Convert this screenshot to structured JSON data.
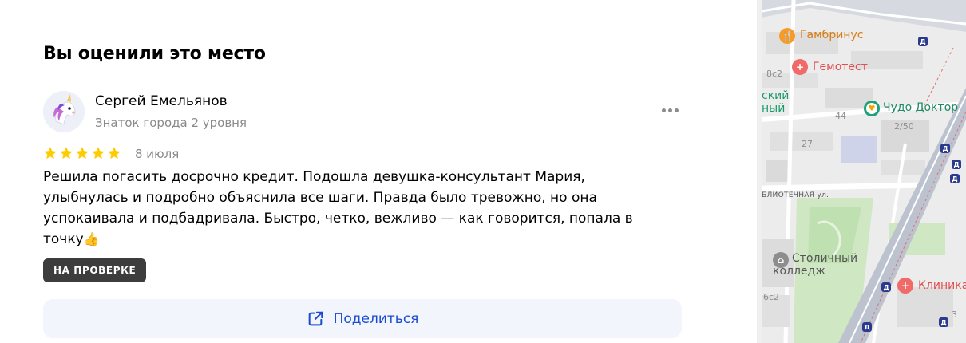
{
  "review": {
    "section_title": "Вы оценили это место",
    "author_name": "Сергей Емельянов",
    "author_level": "Знаток города 2 уровня",
    "avatar_icon": "unicorn-icon",
    "rating": 5,
    "date": "8 июля",
    "text": "Решила погасить досрочно кредит. Подошла девушка-консультант Мария, улыбнулась и подробно объяснила все шаги. Правда было тревожно, но она успокаивала и подбадривала. Быстро, четко, вежливо — как говорится, попала в точку",
    "text_emoji": "👍",
    "status_badge": "НА ПРОВЕРКЕ",
    "share_label": "Поделиться",
    "more_icon": "more-dots-icon"
  },
  "map": {
    "labels": {
      "gambrinus": "Гамбринус",
      "gemotest": "Гемотест",
      "chudo_doktor": "Чудо Доктор",
      "street": "БЛИОТЕЧНАЯ ул.",
      "college": "Столичный колледж",
      "clinic": "Клиника",
      "partial_1": "ский",
      "partial_2": "ный"
    },
    "house_numbers": {
      "h8c2": "8с2",
      "h44": "44",
      "h2_50": "2/50",
      "h27": "27",
      "h6c2": "6с2",
      "h3": "3"
    }
  },
  "colors": {
    "star": "#fc0",
    "share_text": "#1a4bd1",
    "badge_bg": "#3d3d3d",
    "share_bg": "#f2f5fb"
  }
}
